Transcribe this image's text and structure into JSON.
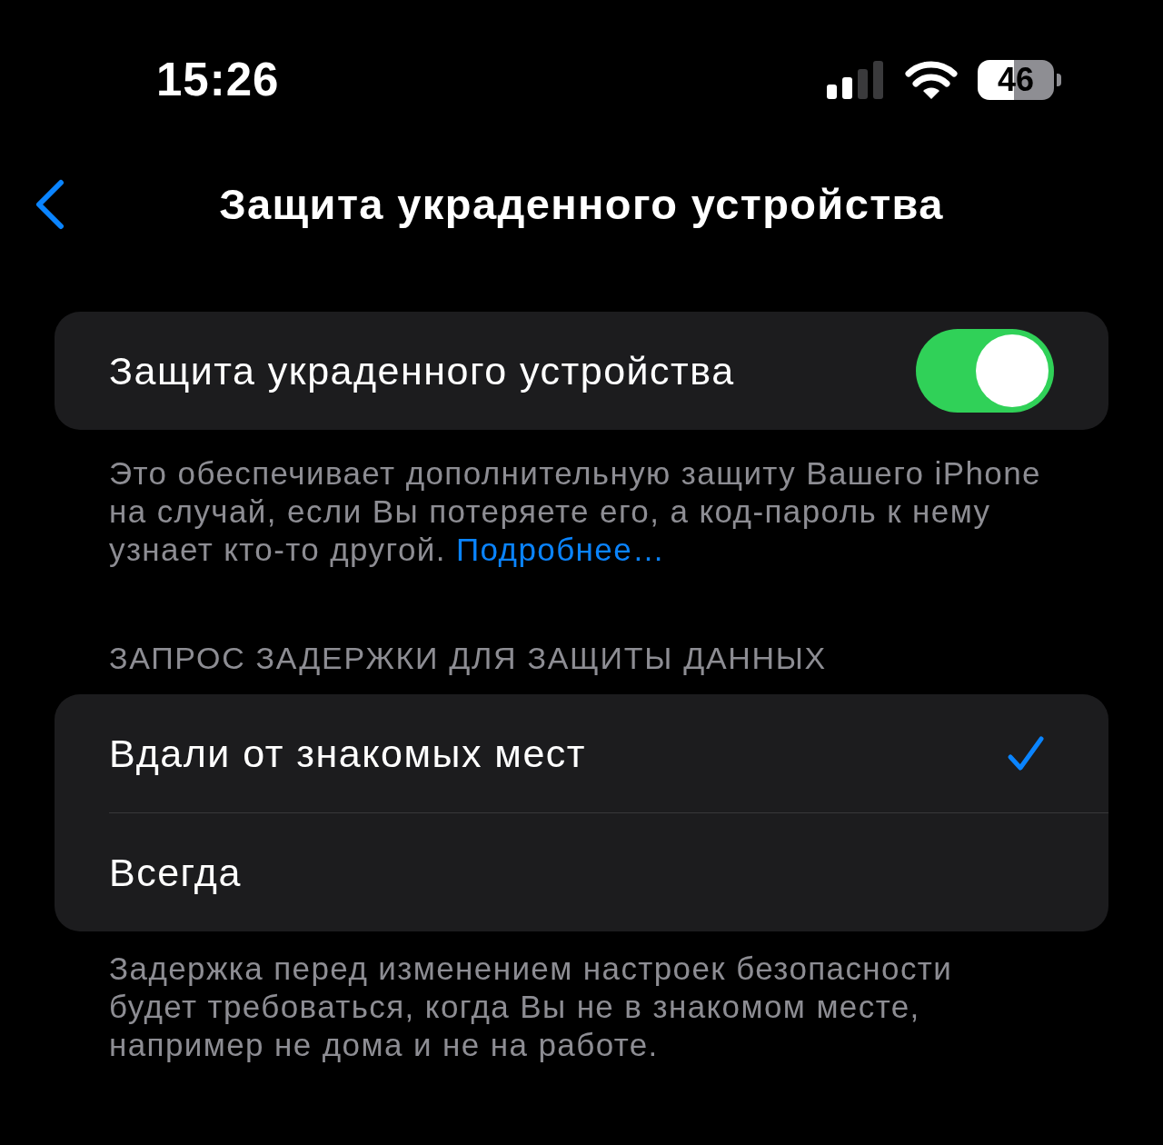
{
  "status_bar": {
    "time": "15:26",
    "battery": "46"
  },
  "nav": {
    "title": "Защита украденного устройства"
  },
  "toggle_section": {
    "label": "Защита украденного устройства",
    "on": true,
    "footer": "Это обеспечивает дополнительную защиту Вашего iPhone на случай, если Вы потеряете его, а код-пароль к нему узнает кто-то другой.",
    "footer_link": "Подробнее…"
  },
  "delay_section": {
    "header": "ЗАПРОС ЗАДЕРЖКИ ДЛЯ ЗАЩИТЫ ДАННЫХ",
    "options": [
      {
        "label": "Вдали от знакомых мест",
        "selected": true
      },
      {
        "label": "Всегда",
        "selected": false
      }
    ],
    "footer": "Задержка перед изменением настроек безопасности будет требоваться, когда Вы не в знакомом месте, например не дома и не на работе."
  }
}
